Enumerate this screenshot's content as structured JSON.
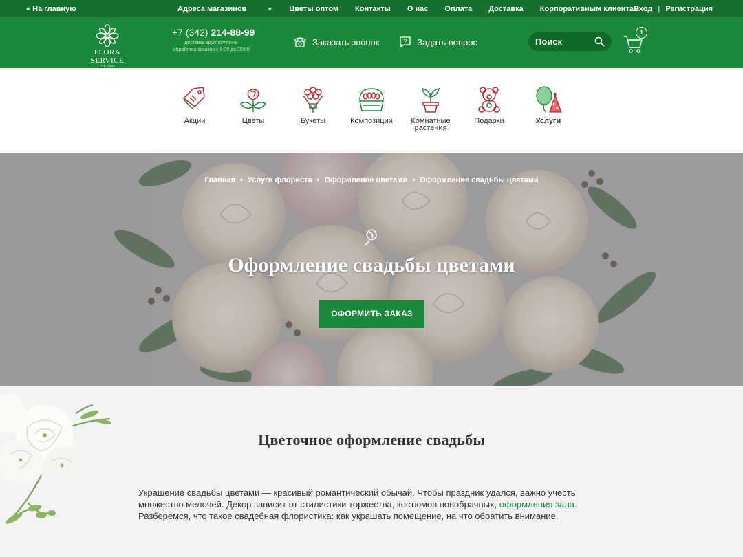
{
  "topbar": {
    "home": "« На главную",
    "nav": [
      "Адреса магазинов",
      "Цветы оптом",
      "Контакты",
      "О нас",
      "Оплата",
      "Доставка",
      "Корпоративным клиентам"
    ],
    "login": "Вход",
    "separator": "|",
    "register": "Регистрация"
  },
  "header": {
    "logo_name": "FLORA SERVICE",
    "logo_est": "Est. 1995",
    "phone_prefix": "+7 (342)",
    "phone_number": "214-88-99",
    "phone_sub1": "доставка круглосуточно",
    "phone_sub2": "обработка заказов с 8:00 до 20:00",
    "callback": "Заказать звонок",
    "question": "Задать вопрос",
    "search_placeholder": "Поиск",
    "cart_count": "1"
  },
  "categories": [
    {
      "label": "Акции",
      "icon": "tag-icon"
    },
    {
      "label": "Цветы",
      "icon": "rose-icon"
    },
    {
      "label": "Букеты",
      "icon": "bouquet-icon"
    },
    {
      "label": "Композиции",
      "icon": "basket-icon"
    },
    {
      "label": "Комнатные растения",
      "icon": "potted-plant-icon"
    },
    {
      "label": "Подарки",
      "icon": "teddy-bear-icon"
    },
    {
      "label": "Услуги",
      "icon": "balloon-icon"
    }
  ],
  "hero": {
    "breadcrumbs": [
      "Главная",
      "Услуги флориста",
      "Оформление цветами",
      "Оформление свадьбы цветами"
    ],
    "title": "Оформление свадьбы цветами",
    "button": "ОФОРМИТЬ ЗАКАЗ"
  },
  "content": {
    "heading": "Цветочное оформление свадьбы",
    "text_before_link": "Украшение свадьбы цветами — красивый романтический обычай. Чтобы праздник удался, важно учесть множество мелочей. Декор зависит от стилистики торжества, костюмов новобрачных, ",
    "link": "оформления зала",
    "text_after_link": ". Разберемся, что такое свадебная флористика: как украшать помещение, на что обратить внимание."
  },
  "colors": {
    "brand_green": "#1a8a3a",
    "topbar_green": "#16702f",
    "icon_red": "#c0282e",
    "icon_green": "#1a8a3a"
  }
}
